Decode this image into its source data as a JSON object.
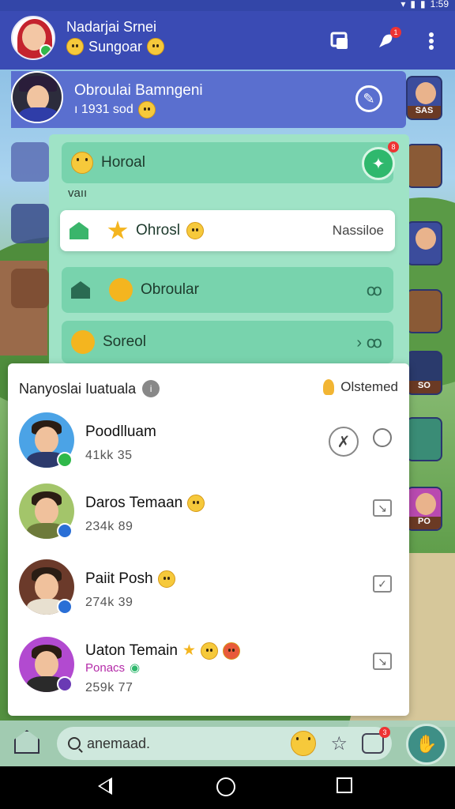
{
  "status_bar": {
    "time": "1:59"
  },
  "app_bar": {
    "title": "Nadarjai Srnei",
    "subtitle": "Sungoar",
    "actions": [
      {
        "icon": "contacts-icon"
      },
      {
        "icon": "notification-icon",
        "badge": "1"
      },
      {
        "icon": "more-vert-icon"
      }
    ]
  },
  "profile": {
    "name": "Obroulai Bamngeni",
    "stats": "ı 1931 sod"
  },
  "side_tiles": [
    {
      "label": "SAS"
    },
    {
      "label": "SO"
    },
    {
      "label": "PO"
    }
  ],
  "menu": {
    "header": {
      "label": "Horoal",
      "right": "×8"
    },
    "section_label": "vaıı",
    "items": [
      {
        "label": "Ohrosl",
        "right": "Nassiloe",
        "selected": true
      },
      {
        "label": "Obroular",
        "right": "ꝏ"
      },
      {
        "label": "Soreol",
        "right": "› ꝏ"
      }
    ]
  },
  "friends": {
    "title": "Nanyoslai Iuatuala",
    "sort_label": "Olstemed",
    "list": [
      {
        "name": "Poodlluam",
        "meta": "41kk 35",
        "status_color": "#2fb84a",
        "shirt": "#2c3a6c",
        "bg": "#4ba3e6",
        "control": "radio"
      },
      {
        "name": "Daros Temaan",
        "meta": "234k 89",
        "status_color": "#2a6fd6",
        "shirt": "#6d7a3a",
        "bg": "#a3c56a",
        "control": "checkbox"
      },
      {
        "name": "Paiit Posh",
        "meta": "274k 39",
        "status_color": "#2a6fd6",
        "shirt": "#e8e0d0",
        "bg": "#6b3a2a",
        "control": "checkbox"
      },
      {
        "name": "Uaton Temain",
        "tag": "Ponacs",
        "meta": "259k 77",
        "status_color": "#6a3ab4",
        "shirt": "#2a2a2a",
        "bg": "#b24ad0",
        "control": "checkbox"
      }
    ]
  },
  "bottom_bar": {
    "search_placeholder": "anemaad.",
    "badge": "3"
  }
}
